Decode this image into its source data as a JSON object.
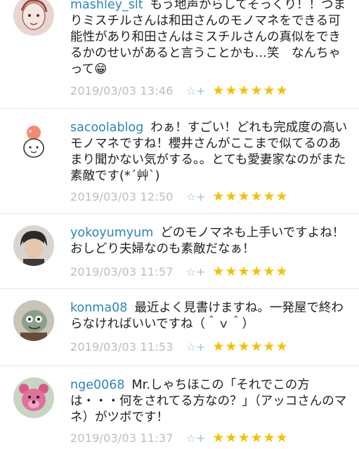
{
  "comments": [
    {
      "username": "mashley_slt",
      "text": "もう地声からしてそっくり！！つまりミスチルさんは和田さんのモノマネをできる可能性があり和田さんはミスチルさんの真似をできるかのせいがあると言うことかも…笑　なんちゃって😁",
      "date": "2019/03/03 13:46",
      "stars": "★★★★★★",
      "rating": 6,
      "avatar": "sketch-face"
    },
    {
      "username": "sacoolablog",
      "text": "わぁ！すごい！どれも完成度の高いモノマネですね！櫻井さんがここまで似てるのあまり聞かない気がする。。とても愛妻家なのがまた素敵です(*´艸`)",
      "date": "2019/03/03 12:50",
      "stars": "★★★★★★",
      "rating": 6,
      "avatar": "cartoon-girl"
    },
    {
      "username": "yokoyumyum",
      "text": "どのモノマネも上手いですよね！おしどり夫婦なのも素敵だなぁ！",
      "date": "2019/03/03 11:57",
      "stars": "★★★★★★",
      "rating": 6,
      "avatar": "person-photo"
    },
    {
      "username": "konma08",
      "text": "最近よく見書けますね。一発屋で終わらなければいいですね（＾ｖ＾）",
      "date": "2019/03/03 11:53",
      "stars": "★★★★★★",
      "rating": 6,
      "avatar": "figure-photo"
    },
    {
      "username": "nge0068",
      "text": "Mr.しゃちほこの「それでこの方は・・・何をされてる方なの？」（アッコさんのマネ）がツボです！",
      "date": "2019/03/03 11:37",
      "stars": "★★★★★★",
      "rating": 6,
      "avatar": "pink-bear"
    }
  ],
  "fav_icon": "☆+",
  "colors": {
    "username": "#2a86b8",
    "date": "#bdbdbd",
    "star": "#f2c100",
    "fav_icon": "#9ec3e0"
  }
}
